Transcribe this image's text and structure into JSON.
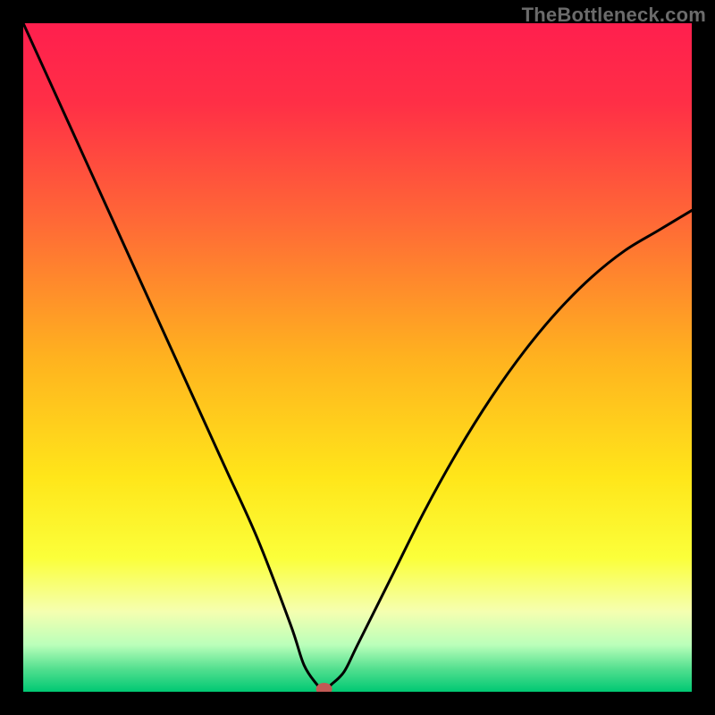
{
  "watermark": "TheBottleneck.com",
  "chart_data": {
    "type": "line",
    "title": "",
    "xlabel": "",
    "ylabel": "",
    "xlim": [
      0,
      100
    ],
    "ylim": [
      0,
      100
    ],
    "series": [
      {
        "name": "bottleneck-curve",
        "x": [
          0,
          5,
          10,
          15,
          20,
          25,
          30,
          35,
          40,
          42,
          44,
          45,
          46,
          48,
          50,
          55,
          60,
          65,
          70,
          75,
          80,
          85,
          90,
          95,
          100
        ],
        "y": [
          100,
          89,
          78,
          67,
          56,
          45,
          34,
          23,
          10,
          4,
          1,
          0,
          1,
          3,
          7,
          17,
          27,
          36,
          44,
          51,
          57,
          62,
          66,
          69,
          72
        ]
      }
    ],
    "marker": {
      "x": 45,
      "y": 0,
      "color": "#c25a55"
    },
    "gradient_stops": [
      {
        "offset": 0.0,
        "color": "#ff1f4e"
      },
      {
        "offset": 0.12,
        "color": "#ff2f46"
      },
      {
        "offset": 0.3,
        "color": "#ff6a36"
      },
      {
        "offset": 0.5,
        "color": "#ffb21f"
      },
      {
        "offset": 0.68,
        "color": "#ffe61a"
      },
      {
        "offset": 0.8,
        "color": "#fbff3a"
      },
      {
        "offset": 0.88,
        "color": "#f5ffb0"
      },
      {
        "offset": 0.93,
        "color": "#baffba"
      },
      {
        "offset": 0.965,
        "color": "#55e090"
      },
      {
        "offset": 1.0,
        "color": "#00c873"
      }
    ]
  }
}
